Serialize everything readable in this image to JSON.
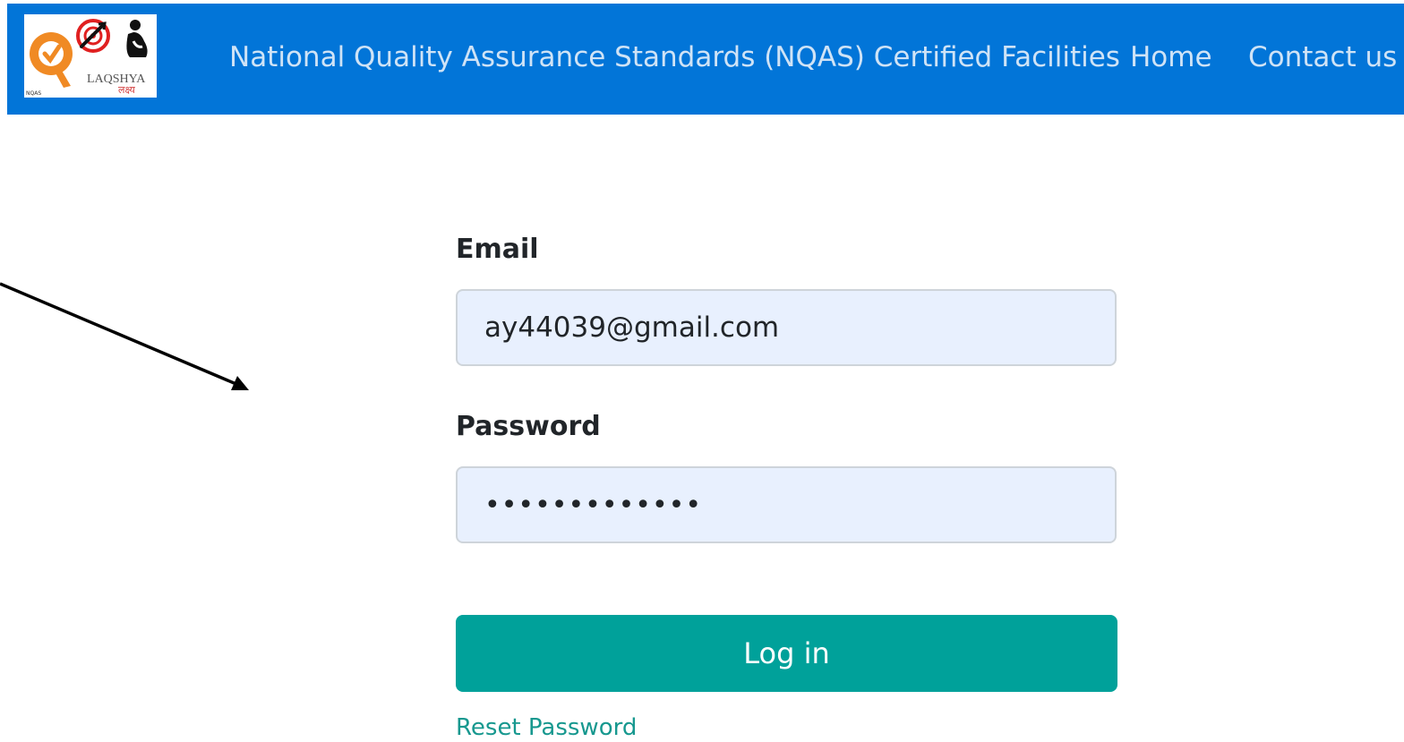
{
  "navbar": {
    "logo": {
      "icon": "laqshya-nqas-logo",
      "text_main": "LAQSHYA",
      "text_hindi": "लक्ष्य",
      "text_small": "NQAS"
    },
    "title": "National Quality Assurance Standards (NQAS) Certified Facilities",
    "links": {
      "home": "Home",
      "contact": "Contact us"
    },
    "bg_color": "#0275d8"
  },
  "annotation": {
    "icon": "pointer-arrow-icon"
  },
  "login_form": {
    "email": {
      "label": "Email",
      "value": "ay44039@gmail.com"
    },
    "password": {
      "label": "Password",
      "value": "•••••••••••••"
    },
    "submit_label": "Log in",
    "submit_color": "#00a19a",
    "reset_label": "Reset Password"
  }
}
